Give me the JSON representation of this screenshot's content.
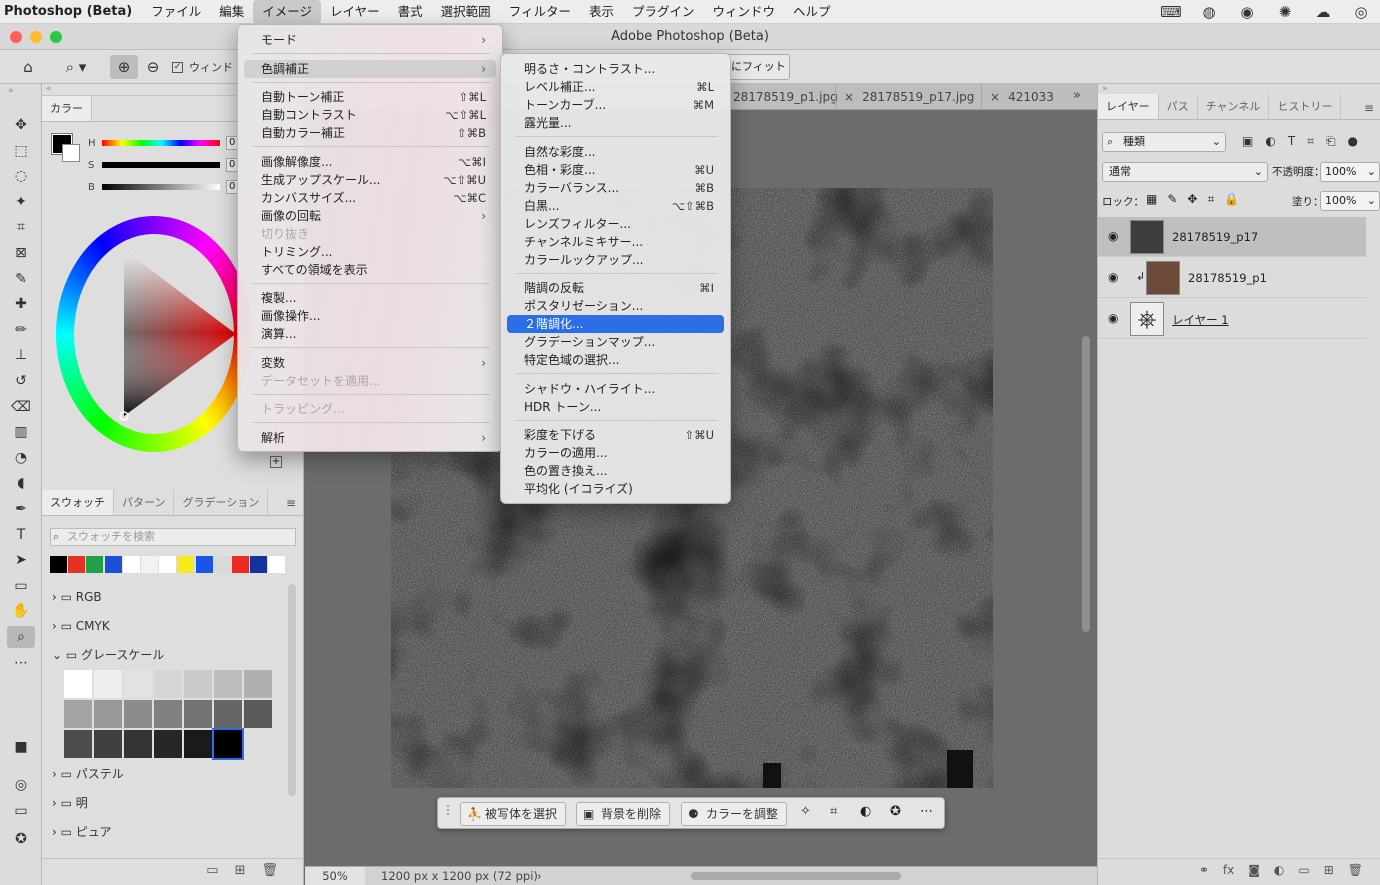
{
  "menubar": {
    "app": "Photoshop (Beta)",
    "items": [
      "ファイル",
      "編集",
      "イメージ",
      "レイヤー",
      "書式",
      "選択範囲",
      "フィルター",
      "表示",
      "プラグイン",
      "ウィンドウ",
      "ヘルプ"
    ],
    "active_index": 2,
    "status_icons": [
      "ime-icon",
      "globe-icon",
      "line-icon",
      "sparkle-icon",
      "creative-cloud-icon",
      "control-icon"
    ]
  },
  "window": {
    "title": "Adobe Photoshop (Beta)"
  },
  "optbar": {
    "checkbox_label": "ウィンド",
    "fit_button": "にフィット"
  },
  "color_panel": {
    "tab": "カラー",
    "sliders": [
      {
        "label": "H",
        "value": "0"
      },
      {
        "label": "S",
        "value": "0"
      },
      {
        "label": "B",
        "value": "0"
      }
    ]
  },
  "swatch_panel": {
    "tabs": [
      "スウォッチ",
      "パターン",
      "グラデーション"
    ],
    "search_placeholder": "スウォッチを検索",
    "swatches": [
      "#000000",
      "#e63222",
      "#21a04a",
      "#1a4fd6",
      "#ffffff",
      "#f2f2f2",
      "#ffffff",
      "#f7ea1a",
      "#1b55e8",
      "#d9d9d9",
      "#e82d20",
      "#14339c",
      "#ffffff"
    ],
    "groups": [
      "RGB",
      "CMYK",
      "グレースケール",
      "パステル",
      "明",
      "ピュア"
    ],
    "gray_rows": [
      [
        "#ffffff",
        "#eeeeee",
        "#e2e2e2",
        "#d6d6d6",
        "#cacaca",
        "#bdbdbd",
        "#b0b0b0"
      ],
      [
        "#a4a4a4",
        "#989898",
        "#8c8c8c",
        "#808080",
        "#737373",
        "#666666",
        "#5a5a5a"
      ],
      [
        "#4d4d4d",
        "#404040",
        "#333333",
        "#262626",
        "#1a1a1a",
        "#0d0d0d"
      ]
    ]
  },
  "doc_tabs": [
    "28178519_p1.jpg",
    "28178519_p17.jpg",
    "421033"
  ],
  "status": {
    "zoom": "50%",
    "info": "1200 px x 1200 px (72 ppi)"
  },
  "layers_panel": {
    "tabs": [
      "レイヤー",
      "パス",
      "チャンネル",
      "ヒストリー"
    ],
    "filter": "種類",
    "blend": "通常",
    "opacity_label": "不透明度：",
    "opacity": "100%",
    "lock_label": "ロック：",
    "fill_label": "塗り：",
    "fill": "100%",
    "layers": [
      {
        "name": "28178519_p17",
        "selected": true
      },
      {
        "name": "28178519_p1",
        "selected": false
      },
      {
        "name": "レイヤー 1",
        "selected": false
      }
    ]
  },
  "image_menu": {
    "items": [
      {
        "label": "モード",
        "shortcut": "",
        "submenu": true,
        "disabled": false
      },
      {
        "sep": true
      },
      {
        "label": "色調補正",
        "shortcut": "",
        "submenu": true,
        "disabled": false,
        "active": true
      },
      {
        "sep": true
      },
      {
        "label": "自動トーン補正",
        "shortcut": "⇧⌘L"
      },
      {
        "label": "自動コントラスト",
        "shortcut": "⌥⇧⌘L"
      },
      {
        "label": "自動カラー補正",
        "shortcut": "⇧⌘B"
      },
      {
        "sep": true
      },
      {
        "label": "画像解像度...",
        "shortcut": "⌥⌘I"
      },
      {
        "label": "生成アップスケール...",
        "shortcut": "⌥⇧⌘U"
      },
      {
        "label": "カンバスサイズ...",
        "shortcut": "⌥⌘C"
      },
      {
        "label": "画像の回転",
        "shortcut": "",
        "submenu": true
      },
      {
        "label": "切り抜き",
        "shortcut": "",
        "disabled": true
      },
      {
        "label": "トリミング...",
        "shortcut": ""
      },
      {
        "label": "すべての領域を表示",
        "shortcut": ""
      },
      {
        "sep": true
      },
      {
        "label": "複製...",
        "shortcut": ""
      },
      {
        "label": "画像操作...",
        "shortcut": ""
      },
      {
        "label": "演算...",
        "shortcut": ""
      },
      {
        "sep": true
      },
      {
        "label": "変数",
        "shortcut": "",
        "submenu": true
      },
      {
        "label": "データセットを適用...",
        "shortcut": "",
        "disabled": true
      },
      {
        "sep": true
      },
      {
        "label": "トラッピング...",
        "shortcut": "",
        "disabled": true
      },
      {
        "sep": true
      },
      {
        "label": "解析",
        "shortcut": "",
        "submenu": true
      }
    ]
  },
  "adjust_menu": {
    "items": [
      {
        "label": "明るさ・コントラスト...",
        "shortcut": ""
      },
      {
        "label": "レベル補正...",
        "shortcut": "⌘L"
      },
      {
        "label": "トーンカーブ...",
        "shortcut": "⌘M"
      },
      {
        "label": "露光量...",
        "shortcut": ""
      },
      {
        "sep": true
      },
      {
        "label": "自然な彩度...",
        "shortcut": ""
      },
      {
        "label": "色相・彩度...",
        "shortcut": "⌘U"
      },
      {
        "label": "カラーバランス...",
        "shortcut": "⌘B"
      },
      {
        "label": "白黒...",
        "shortcut": "⌥⇧⌘B"
      },
      {
        "label": "レンズフィルター...",
        "shortcut": ""
      },
      {
        "label": "チャンネルミキサー...",
        "shortcut": ""
      },
      {
        "label": "カラールックアップ...",
        "shortcut": ""
      },
      {
        "sep": true
      },
      {
        "label": "階調の反転",
        "shortcut": "⌘I"
      },
      {
        "label": "ポスタリゼーション...",
        "shortcut": ""
      },
      {
        "label": "２階調化...",
        "shortcut": "",
        "highlight": true
      },
      {
        "label": "グラデーションマップ...",
        "shortcut": ""
      },
      {
        "label": "特定色域の選択...",
        "shortcut": ""
      },
      {
        "sep": true
      },
      {
        "label": "シャドウ・ハイライト...",
        "shortcut": ""
      },
      {
        "label": "HDR トーン...",
        "shortcut": ""
      },
      {
        "sep": true
      },
      {
        "label": "彩度を下げる",
        "shortcut": "⇧⌘U"
      },
      {
        "label": "カラーの適用...",
        "shortcut": ""
      },
      {
        "label": "色の置き換え...",
        "shortcut": ""
      },
      {
        "label": "平均化 (イコライズ)",
        "shortcut": ""
      }
    ]
  },
  "context_bar": {
    "buttons": [
      "被写体を選択",
      "背景を削除",
      "カラーを調整"
    ]
  }
}
